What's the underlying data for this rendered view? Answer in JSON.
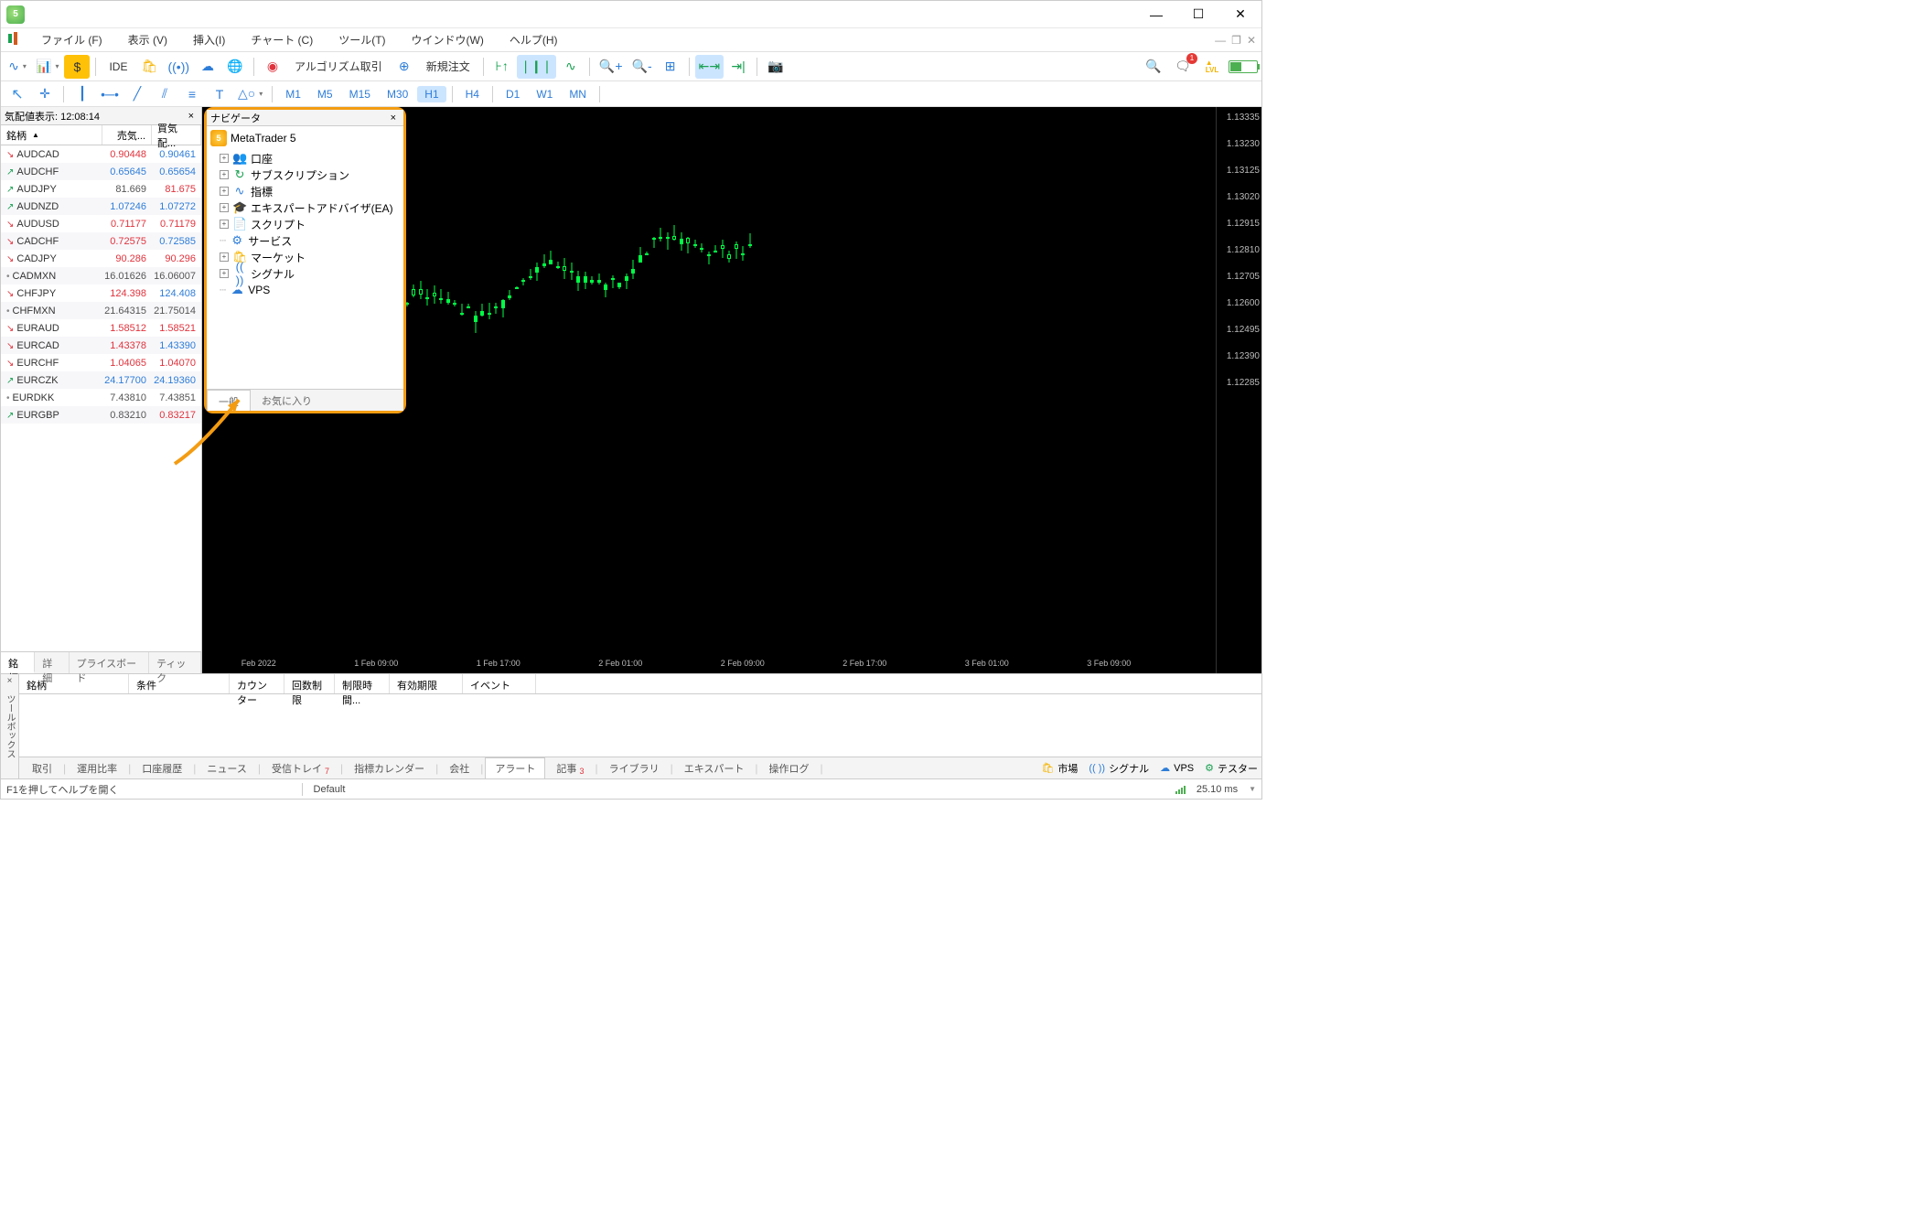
{
  "menu": {
    "file": "ファイル (F)",
    "view": "表示 (V)",
    "insert": "挿入(I)",
    "chart": "チャート (C)",
    "tool": "ツール(T)",
    "window": "ウインドウ(W)",
    "help": "ヘルプ(H)"
  },
  "toolbar": {
    "ide": "IDE",
    "algo": "アルゴリズム取引",
    "neworder": "新規注文"
  },
  "tf": [
    "M1",
    "M5",
    "M15",
    "M30",
    "H1",
    "H4",
    "D1",
    "W1",
    "MN"
  ],
  "tf_active": "H1",
  "mw": {
    "title": "気配値表示: 12:08:14",
    "cols": {
      "sym": "銘柄",
      "bid": "売気...",
      "ask": "買気配..."
    },
    "rows": [
      {
        "d": "down",
        "s": "AUDCAD",
        "b": "0.90448",
        "a": "0.90461",
        "bc": "down",
        "ac": "up"
      },
      {
        "d": "up",
        "s": "AUDCHF",
        "b": "0.65645",
        "a": "0.65654",
        "bc": "up",
        "ac": "up"
      },
      {
        "d": "up",
        "s": "AUDJPY",
        "b": "81.669",
        "a": "81.675",
        "bc": "flat",
        "ac": "down"
      },
      {
        "d": "up",
        "s": "AUDNZD",
        "b": "1.07246",
        "a": "1.07272",
        "bc": "up",
        "ac": "up"
      },
      {
        "d": "down",
        "s": "AUDUSD",
        "b": "0.71177",
        "a": "0.71179",
        "bc": "down",
        "ac": "down"
      },
      {
        "d": "down",
        "s": "CADCHF",
        "b": "0.72575",
        "a": "0.72585",
        "bc": "down",
        "ac": "up"
      },
      {
        "d": "down",
        "s": "CADJPY",
        "b": "90.286",
        "a": "90.296",
        "bc": "down",
        "ac": "down"
      },
      {
        "d": "flat",
        "s": "CADMXN",
        "b": "16.01626",
        "a": "16.06007",
        "bc": "flat",
        "ac": "flat"
      },
      {
        "d": "down",
        "s": "CHFJPY",
        "b": "124.398",
        "a": "124.408",
        "bc": "down",
        "ac": "up"
      },
      {
        "d": "flat",
        "s": "CHFMXN",
        "b": "21.64315",
        "a": "21.75014",
        "bc": "flat",
        "ac": "flat"
      },
      {
        "d": "down",
        "s": "EURAUD",
        "b": "1.58512",
        "a": "1.58521",
        "bc": "down",
        "ac": "down"
      },
      {
        "d": "down",
        "s": "EURCAD",
        "b": "1.43378",
        "a": "1.43390",
        "bc": "down",
        "ac": "up"
      },
      {
        "d": "down",
        "s": "EURCHF",
        "b": "1.04065",
        "a": "1.04070",
        "bc": "down",
        "ac": "down"
      },
      {
        "d": "up",
        "s": "EURCZK",
        "b": "24.17700",
        "a": "24.19360",
        "bc": "up",
        "ac": "up"
      },
      {
        "d": "flat",
        "s": "EURDKK",
        "b": "7.43810",
        "a": "7.43851",
        "bc": "flat",
        "ac": "flat"
      },
      {
        "d": "up",
        "s": "EURGBP",
        "b": "0.83210",
        "a": "0.83217",
        "bc": "flat",
        "ac": "down"
      }
    ],
    "tabs": [
      "銘柄",
      "詳細",
      "プライスボード",
      "ティック"
    ]
  },
  "nav": {
    "title": "ナビゲータ",
    "root": "MetaTrader 5",
    "items": [
      {
        "icon": "👥",
        "ic": "#3a8fe0",
        "label": "口座",
        "pm": true
      },
      {
        "icon": "↻",
        "ic": "#18a050",
        "label": "サブスクリプション",
        "pm": true
      },
      {
        "icon": "∿",
        "ic": "#2e7dd8",
        "label": "指標",
        "pm": true
      },
      {
        "icon": "🎓",
        "ic": "#2e7dd8",
        "label": "エキスパートアドバイザ(EA)",
        "pm": true
      },
      {
        "icon": "📄",
        "ic": "#f5b400",
        "label": "スクリプト",
        "pm": true
      },
      {
        "icon": "⚙",
        "ic": "#2e7dd8",
        "label": "サービス",
        "pm": false
      },
      {
        "icon": "🛍",
        "ic": "#f5b400",
        "label": "マーケット",
        "pm": true
      },
      {
        "icon": "(( ))",
        "ic": "#2e7dd8",
        "label": "シグナル",
        "pm": true
      },
      {
        "icon": "☁",
        "ic": "#2e7dd8",
        "label": "VPS",
        "pm": false
      }
    ],
    "tabs": [
      "一般",
      "お気に入り"
    ]
  },
  "chart": {
    "prices": [
      "1.13335",
      "1.13230",
      "1.13125",
      "1.13020",
      "1.12915",
      "1.12810",
      "1.12705",
      "1.12600",
      "1.12495",
      "1.12390",
      "1.12285"
    ],
    "times": [
      "  Feb 2022",
      "1 Feb 09:00",
      "1 Feb 17:00",
      "2 Feb 01:00",
      "2 Feb 09:00",
      "2 Feb 17:00",
      "3 Feb 01:00",
      "3 Feb 09:00"
    ]
  },
  "toolbox": {
    "side": "ツールボックス",
    "cols": [
      "銘柄",
      "条件",
      "カウンター",
      "回数制限",
      "制限時間...",
      "有効期限",
      "イベント"
    ],
    "tabs": [
      {
        "l": "取引"
      },
      {
        "l": "運用比率"
      },
      {
        "l": "口座履歴"
      },
      {
        "l": "ニュース"
      },
      {
        "l": "受信トレイ",
        "b": "7"
      },
      {
        "l": "指標カレンダー"
      },
      {
        "l": "会社"
      },
      {
        "l": "アラート",
        "a": true
      },
      {
        "l": "記事",
        "b": "3"
      },
      {
        "l": "ライブラリ"
      },
      {
        "l": "エキスパート"
      },
      {
        "l": "操作ログ"
      }
    ],
    "right": [
      {
        "i": "🛍",
        "c": "#f5b400",
        "l": "市場"
      },
      {
        "i": "(( ))",
        "c": "#2e7dd8",
        "l": "シグナル"
      },
      {
        "i": "☁",
        "c": "#2e7dd8",
        "l": "VPS"
      },
      {
        "i": "⚙",
        "c": "#18a050",
        "l": "テスター"
      }
    ]
  },
  "status": {
    "help": "F1を押してヘルプを開く",
    "profile": "Default",
    "ping": "25.10 ms"
  }
}
